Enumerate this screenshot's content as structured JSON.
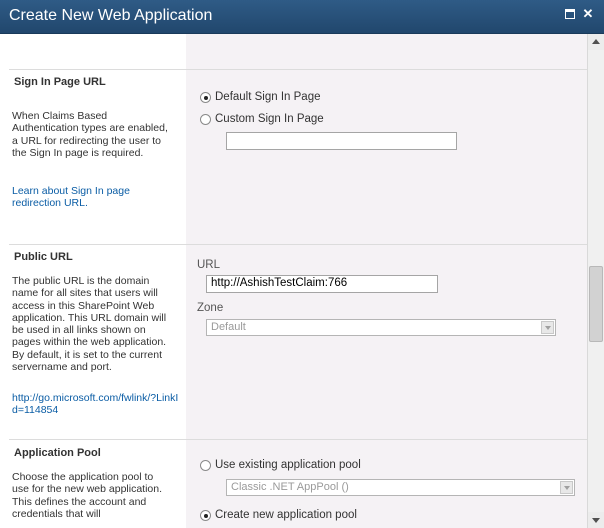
{
  "window": {
    "title": "Create New Web Application",
    "maximize_icon": "maximize-icon",
    "close_icon": "close-icon",
    "close_glyph": "✕"
  },
  "colors": {
    "titlebar": "#2a5480",
    "right_panel": "#f5f2f5",
    "link": "#0b5da5"
  },
  "sign_in": {
    "title": "Sign In Page URL",
    "description": "When Claims Based Authentication types are enabled, a URL for redirecting the user to the Sign In page is required.",
    "link": "Learn about Sign In page redirection URL.",
    "options": [
      {
        "label": "Default Sign In Page",
        "checked": true
      },
      {
        "label": "Custom Sign In Page",
        "checked": false
      }
    ],
    "custom_url_value": ""
  },
  "public_url": {
    "title": "Public URL",
    "description": "The public URL is the domain name for all sites that users will access in this SharePoint Web application.  This URL domain will be used in all links shown on pages within the web application.  By default, it is set to the current servername and port.",
    "link": "http://go.microsoft.com/fwlink/?LinkId=114854",
    "url_label": "URL",
    "url_value": "http://AshishTestClaim:766",
    "zone_label": "Zone",
    "zone_value": "Default"
  },
  "app_pool": {
    "title": "Application Pool",
    "description": "Choose the application pool to use for the new web application.  This defines the account and credentials that will",
    "options": [
      {
        "label": "Use existing application pool",
        "checked": false
      },
      {
        "label": "Create new application pool",
        "checked": true
      }
    ],
    "existing_pool_value": "Classic .NET AppPool ()"
  }
}
